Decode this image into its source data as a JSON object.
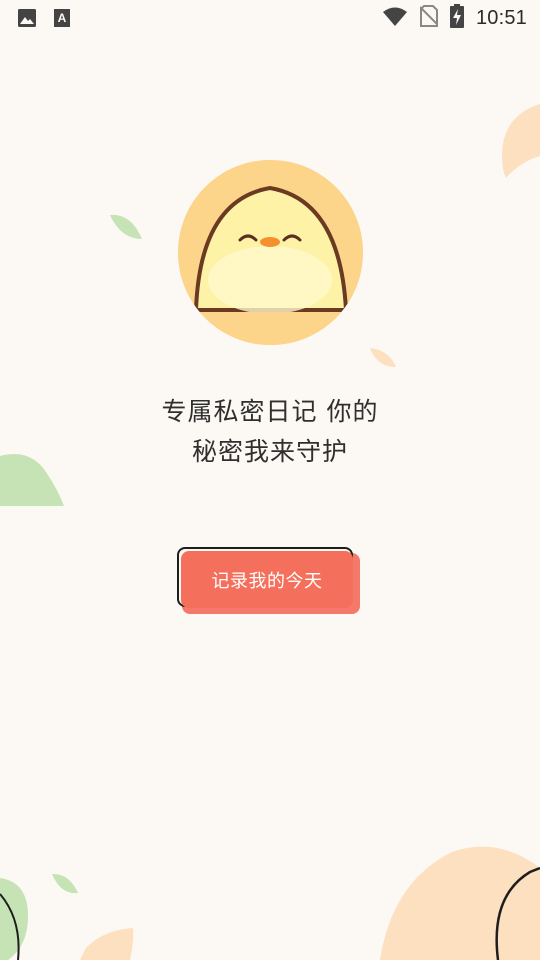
{
  "status_bar": {
    "time": "10:51",
    "left_icons": [
      "gallery-icon",
      "font-a-icon"
    ],
    "right_icons": [
      "wifi-icon",
      "no-sim-icon",
      "battery-charging-icon"
    ]
  },
  "main": {
    "tagline_line1": "专属私密日记 你的",
    "tagline_line2": "秘密我来守护",
    "primary_button_label": "记录我的今天",
    "avatar_icon": "chick-icon"
  },
  "colors": {
    "background": "#fcf8f3",
    "button": "#f5705c",
    "leaf_green": "#c5e3b5",
    "peach": "#fde0bf",
    "avatar_bg": "#fdd58a"
  }
}
